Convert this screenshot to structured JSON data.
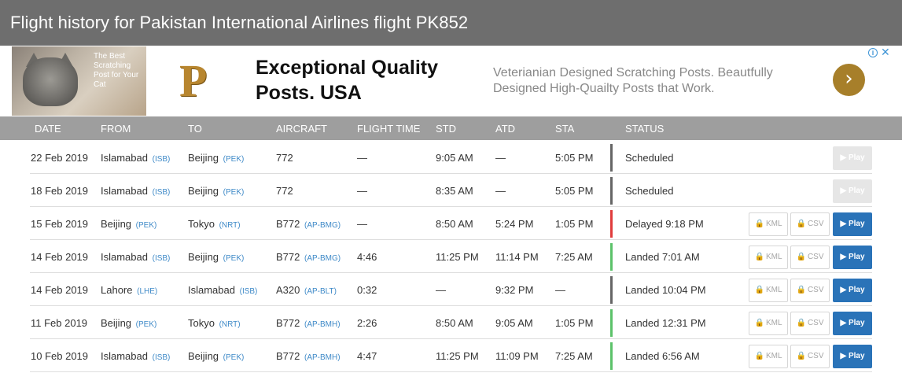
{
  "page_title": "Flight history for Pakistan International Airlines flight PK852",
  "ad": {
    "image_text": "The Best Scratching Post for Your Cat",
    "logo": "P",
    "headline": "Exceptional Quality Posts. USA",
    "description": "Veterianian Designed Scratching Posts. Beautfully Designed High-Quailty Posts that Work.",
    "arrow": "›",
    "info": "i",
    "close": "✕"
  },
  "columns": {
    "date": "DATE",
    "from": "FROM",
    "to": "TO",
    "aircraft": "AIRCRAFT",
    "flight_time": "FLIGHT TIME",
    "std": "STD",
    "atd": "ATD",
    "sta": "STA",
    "status": "STATUS"
  },
  "buttons": {
    "kml": "KML",
    "csv": "CSV",
    "play": "▶ Play",
    "lock": "🔒"
  },
  "status_colors": {
    "scheduled": "#666666",
    "delayed": "#e03c3c",
    "landed": "#5cc26a",
    "unknown": "#666666"
  },
  "rows": [
    {
      "date": "22 Feb 2019",
      "from": "Islamabad",
      "from_code": "(ISB)",
      "to": "Beijing",
      "to_code": "(PEK)",
      "aircraft": "772",
      "aircraft_reg": "",
      "flight_time": "—",
      "std": "9:05 AM",
      "atd": "—",
      "sta": "5:05 PM",
      "status": "Scheduled",
      "status_kind": "scheduled",
      "downloads": false
    },
    {
      "date": "18 Feb 2019",
      "from": "Islamabad",
      "from_code": "(ISB)",
      "to": "Beijing",
      "to_code": "(PEK)",
      "aircraft": "772",
      "aircraft_reg": "",
      "flight_time": "—",
      "std": "8:35 AM",
      "atd": "—",
      "sta": "5:05 PM",
      "status": "Scheduled",
      "status_kind": "scheduled",
      "downloads": false
    },
    {
      "date": "15 Feb 2019",
      "from": "Beijing",
      "from_code": "(PEK)",
      "to": "Tokyo",
      "to_code": "(NRT)",
      "aircraft": "B772",
      "aircraft_reg": "(AP-BMG)",
      "flight_time": "—",
      "std": "8:50 AM",
      "atd": "5:24 PM",
      "sta": "1:05 PM",
      "status": "Delayed 9:18 PM",
      "status_kind": "delayed",
      "downloads": true
    },
    {
      "date": "14 Feb 2019",
      "from": "Islamabad",
      "from_code": "(ISB)",
      "to": "Beijing",
      "to_code": "(PEK)",
      "aircraft": "B772",
      "aircraft_reg": "(AP-BMG)",
      "flight_time": "4:46",
      "std": "11:25 PM",
      "atd": "11:14 PM",
      "sta": "7:25 AM",
      "status": "Landed 7:01 AM",
      "status_kind": "landed",
      "downloads": true
    },
    {
      "date": "14 Feb 2019",
      "from": "Lahore",
      "from_code": "(LHE)",
      "to": "Islamabad",
      "to_code": "(ISB)",
      "aircraft": "A320",
      "aircraft_reg": "(AP-BLT)",
      "flight_time": "0:32",
      "std": "—",
      "atd": "9:32 PM",
      "sta": "—",
      "status": "Landed 10:04 PM",
      "status_kind": "unknown",
      "downloads": true
    },
    {
      "date": "11 Feb 2019",
      "from": "Beijing",
      "from_code": "(PEK)",
      "to": "Tokyo",
      "to_code": "(NRT)",
      "aircraft": "B772",
      "aircraft_reg": "(AP-BMH)",
      "flight_time": "2:26",
      "std": "8:50 AM",
      "atd": "9:05 AM",
      "sta": "1:05 PM",
      "status": "Landed 12:31 PM",
      "status_kind": "landed",
      "downloads": true
    },
    {
      "date": "10 Feb 2019",
      "from": "Islamabad",
      "from_code": "(ISB)",
      "to": "Beijing",
      "to_code": "(PEK)",
      "aircraft": "B772",
      "aircraft_reg": "(AP-BMH)",
      "flight_time": "4:47",
      "std": "11:25 PM",
      "atd": "11:09 PM",
      "sta": "7:25 AM",
      "status": "Landed 6:56 AM",
      "status_kind": "landed",
      "downloads": true
    }
  ]
}
